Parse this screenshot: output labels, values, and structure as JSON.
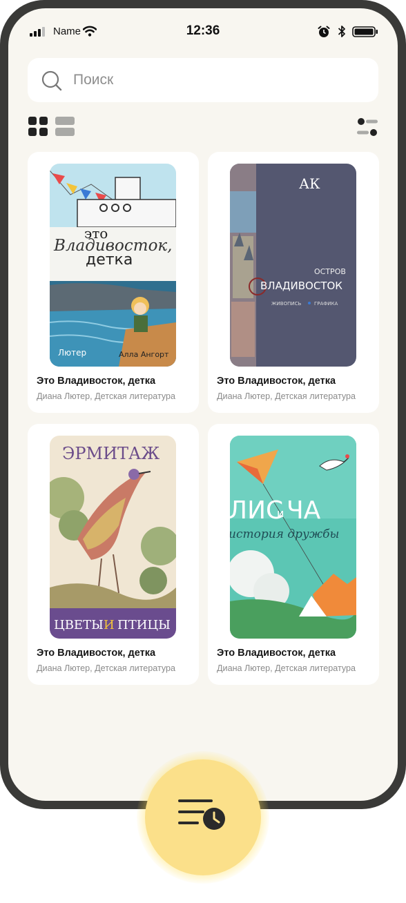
{
  "status_bar": {
    "carrier": "Name",
    "time": "12:36"
  },
  "search": {
    "placeholder": "Поиск"
  },
  "view_toggles": [
    "grid-view",
    "list-view",
    "filter"
  ],
  "books": [
    {
      "title": "Это Владивосток, детка",
      "subtitle": "Диана Лютер, Детская литература",
      "cover_text": [
        "это",
        "Владивосток,",
        "детка",
        "Лютер",
        "Алла Ангорт"
      ]
    },
    {
      "title": "Это Владивосток, детка",
      "subtitle": "Диана Лютер, Детская литература",
      "cover_text": [
        "АК",
        "ОСТРОВ",
        "ВЛАДИВОСТОК",
        "ЖИВОПИСЬ",
        "ГРАФИКА"
      ]
    },
    {
      "title": "Это Владивосток, детка",
      "subtitle": "Диана Лютер, Детская литература",
      "cover_text": [
        "ЭРМИТАЖ",
        "ЦВЕТЫ",
        "И",
        "ПТИЦЫ"
      ]
    },
    {
      "title": "Это Владивосток, детка",
      "subtitle": "Диана Лютер, Детская литература",
      "cover_text": [
        "ЛИС",
        "и",
        "ЧА",
        "история дружбы"
      ]
    }
  ],
  "colors": {
    "background": "#f8f6f0",
    "card": "#ffffff",
    "accent_yellow": "#fbe08a",
    "phone_frame": "#3a3a38"
  },
  "fab": {
    "icon": "history-icon"
  }
}
